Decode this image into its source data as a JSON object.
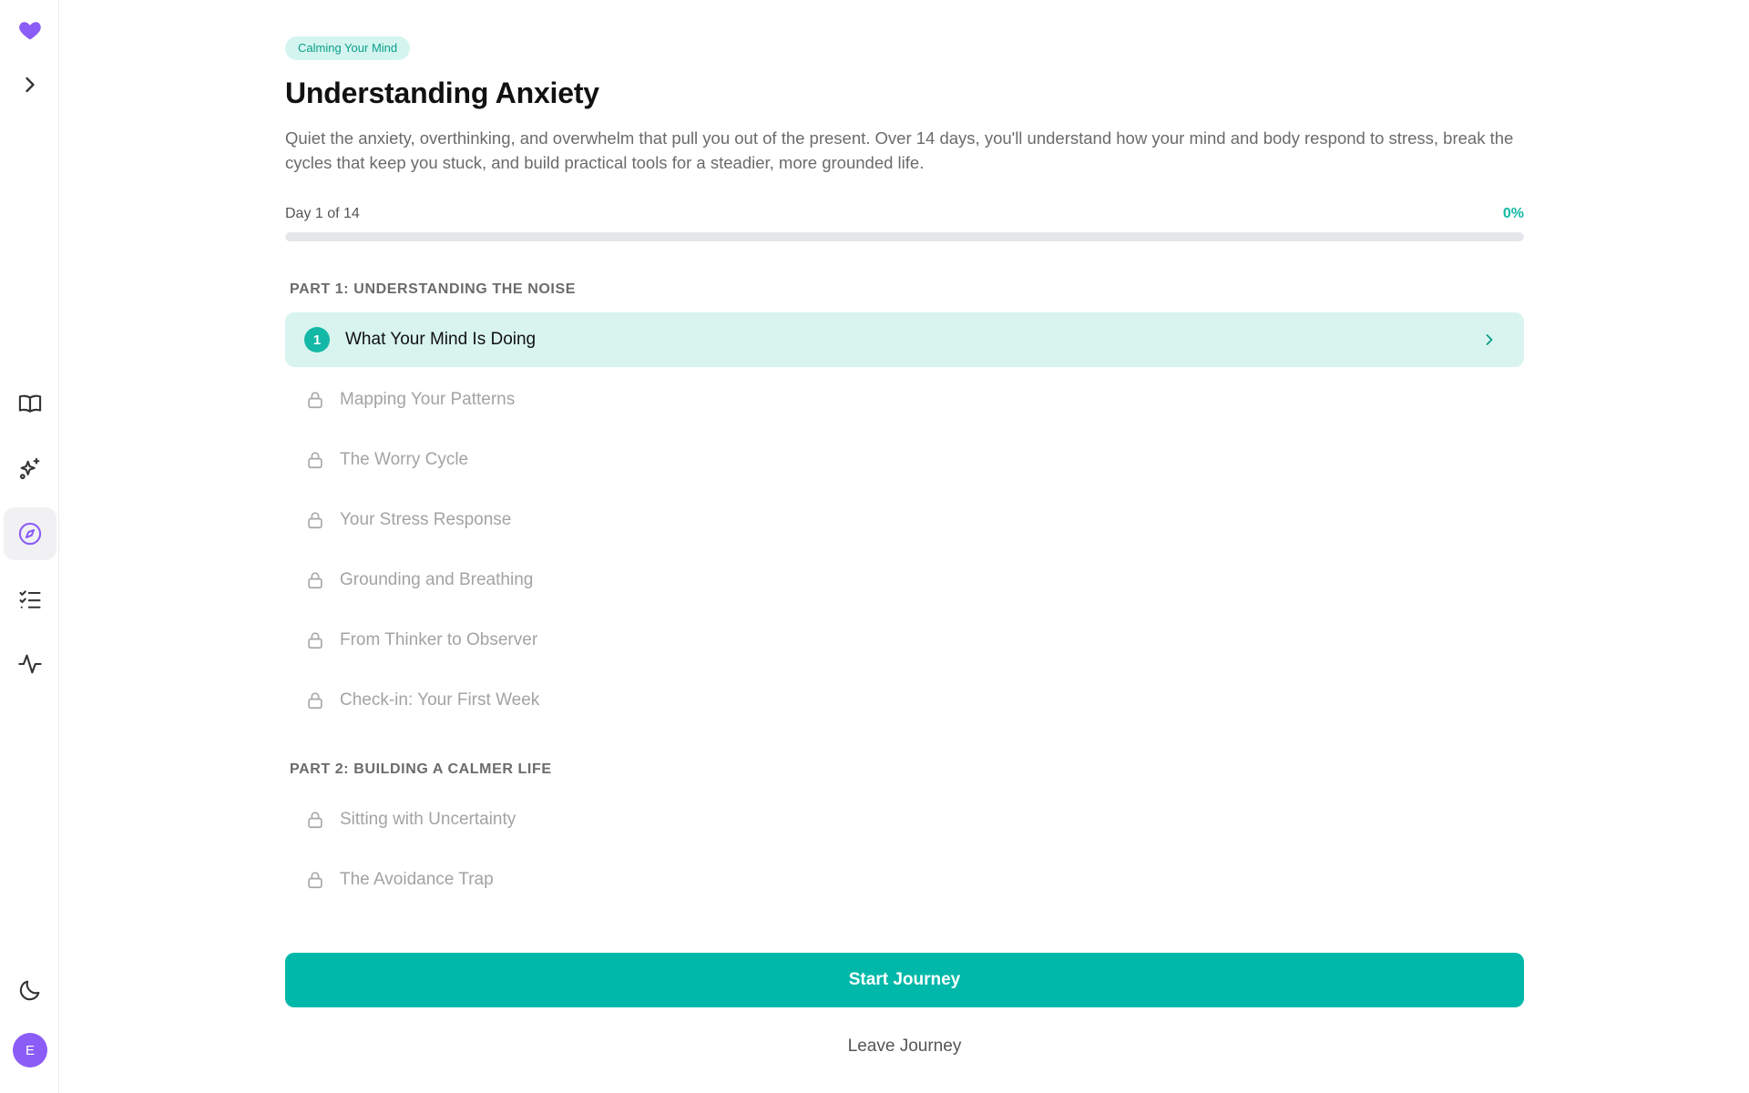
{
  "app": {
    "accent": "#14b8a6",
    "brand": "#8b5cf6"
  },
  "sidebar": {
    "top": [
      {
        "icon": "heart-icon",
        "name": "logo"
      },
      {
        "icon": "chevron-right-icon",
        "name": "expand-sidebar-button"
      }
    ],
    "nav": [
      {
        "icon": "book-open-icon",
        "name": "nav-library"
      },
      {
        "icon": "sparkles-icon",
        "name": "nav-sparkles"
      },
      {
        "icon": "compass-icon",
        "name": "nav-explore",
        "active": true
      },
      {
        "icon": "checklist-icon",
        "name": "nav-tasks"
      },
      {
        "icon": "activity-icon",
        "name": "nav-activity"
      }
    ],
    "bottom": [
      {
        "icon": "moon-icon",
        "name": "theme-toggle"
      }
    ],
    "avatar_initial": "E"
  },
  "journey": {
    "tag": "Calming Your Mind",
    "title": "Understanding Anxiety",
    "description": "Quiet the anxiety, overthinking, and overwhelm that pull you out of the present. Over 14 days, you'll understand how your mind and body respond to stress, break the cycles that keep you stuck, and build practical tools for a steadier, more grounded life.",
    "progress_label": "Day 1 of 14",
    "progress_percent_label": "0%",
    "progress_fraction": 0
  },
  "parts": [
    {
      "title": "PART 1: UNDERSTANDING THE NOISE",
      "items": [
        {
          "number": "1",
          "label": "What Your Mind Is Doing",
          "state": "current"
        },
        {
          "label": "Mapping Your Patterns",
          "state": "locked"
        },
        {
          "label": "The Worry Cycle",
          "state": "locked"
        },
        {
          "label": "Your Stress Response",
          "state": "locked"
        },
        {
          "label": "Grounding and Breathing",
          "state": "locked"
        },
        {
          "label": "From Thinker to Observer",
          "state": "locked"
        },
        {
          "label": "Check-in: Your First Week",
          "state": "locked"
        }
      ]
    },
    {
      "title": "PART 2: BUILDING A CALMER LIFE",
      "items": [
        {
          "label": "Sitting with Uncertainty",
          "state": "locked"
        },
        {
          "label": "The Avoidance Trap",
          "state": "locked"
        }
      ]
    }
  ],
  "actions": {
    "start_label": "Start Journey",
    "leave_label": "Leave Journey"
  }
}
